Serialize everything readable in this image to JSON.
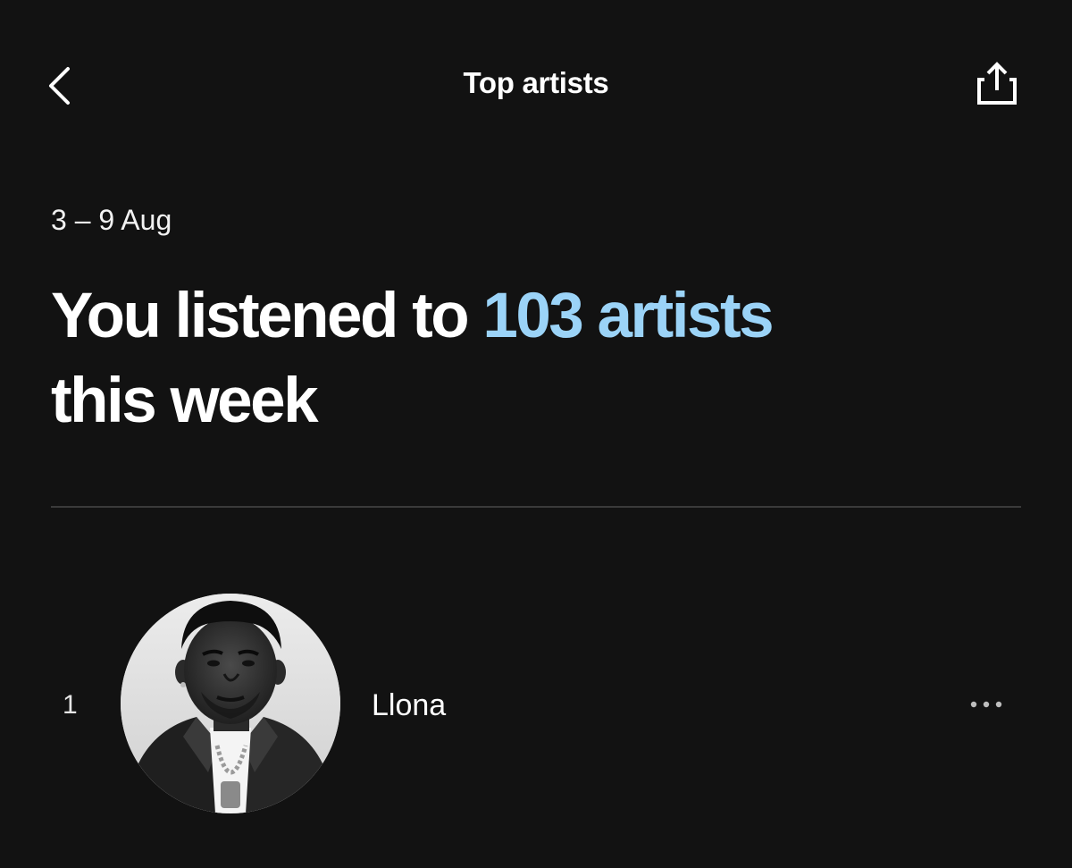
{
  "header": {
    "title": "Top artists",
    "back_icon": "chevron-left-icon",
    "share_icon": "share-icon"
  },
  "summary": {
    "date_range": "3 – 9 Aug",
    "headline_prefix": "You listened to ",
    "headline_highlight": "103 artists",
    "headline_suffix": "this week",
    "accent_color": "#9bd3f7"
  },
  "artists": [
    {
      "rank": "1",
      "name": "Llona",
      "more_icon": "more-horizontal-icon"
    }
  ]
}
